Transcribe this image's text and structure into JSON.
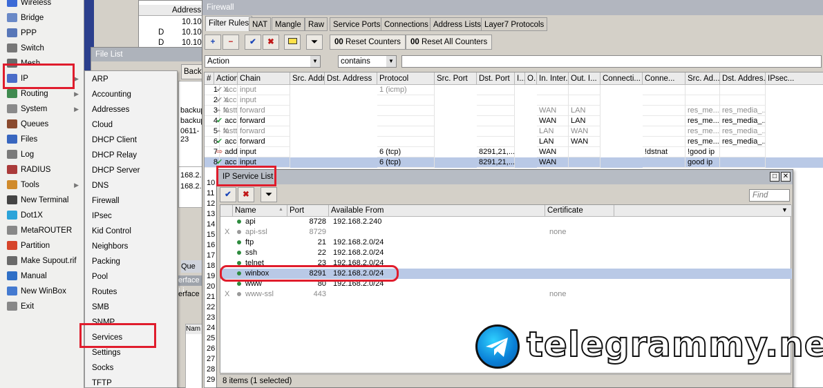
{
  "left_menu": {
    "items": [
      {
        "label": "Wireless",
        "icon": "wireless-icon",
        "arrow": false
      },
      {
        "label": "Bridge",
        "icon": "bridge-icon",
        "arrow": false
      },
      {
        "label": "PPP",
        "icon": "ppp-icon",
        "arrow": false
      },
      {
        "label": "Switch",
        "icon": "switch-icon",
        "arrow": false
      },
      {
        "label": "Mesh",
        "icon": "mesh-icon",
        "arrow": false
      },
      {
        "label": "IP",
        "icon": "ip-icon",
        "arrow": true
      },
      {
        "label": "Routing",
        "icon": "routing-icon",
        "arrow": true
      },
      {
        "label": "System",
        "icon": "system-icon",
        "arrow": true
      },
      {
        "label": "Queues",
        "icon": "queues-icon",
        "arrow": false
      },
      {
        "label": "Files",
        "icon": "files-icon",
        "arrow": false
      },
      {
        "label": "Log",
        "icon": "log-icon",
        "arrow": false
      },
      {
        "label": "RADIUS",
        "icon": "radius-icon",
        "arrow": false
      },
      {
        "label": "Tools",
        "icon": "tools-icon",
        "arrow": true
      },
      {
        "label": "New Terminal",
        "icon": "terminal-icon",
        "arrow": false
      },
      {
        "label": "Dot1X",
        "icon": "dot1x-icon",
        "arrow": false
      },
      {
        "label": "MetaROUTER",
        "icon": "metarouter-icon",
        "arrow": false
      },
      {
        "label": "Partition",
        "icon": "partition-icon",
        "arrow": false
      },
      {
        "label": "Make Supout.rif",
        "icon": "supout-icon",
        "arrow": false
      },
      {
        "label": "Manual",
        "icon": "manual-icon",
        "arrow": false
      },
      {
        "label": "New WinBox",
        "icon": "winbox-icon",
        "arrow": false
      },
      {
        "label": "Exit",
        "icon": "exit-icon",
        "arrow": false
      }
    ]
  },
  "ip_submenu": {
    "items": [
      "ARP",
      "Accounting",
      "Addresses",
      "Cloud",
      "DHCP Client",
      "DHCP Relay",
      "DHCP Server",
      "DNS",
      "Firewall",
      "IPsec",
      "Kid Control",
      "Neighbors",
      "Packing",
      "Pool",
      "Routes",
      "SMB",
      "SNMP",
      "Services",
      "Settings",
      "Socks",
      "TFTP"
    ]
  },
  "background": {
    "top_header": "Address",
    "top_rows": [
      "10.10",
      "10.10",
      "10.10"
    ],
    "top_flags": [
      "",
      "D",
      "D"
    ],
    "file_list_title": "File List",
    "file_list_back": "Back",
    "file_rows": [
      "backup",
      "backup",
      "0611-23"
    ],
    "mid_rows": [
      "168.2.",
      "168.2."
    ],
    "side_labels": [
      "Que",
      "erface Li",
      "erface"
    ],
    "name_col": "Nam"
  },
  "firewall": {
    "title": "Firewall",
    "tabs": [
      "Filter Rules",
      "NAT",
      "Mangle",
      "Raw",
      "Service Ports",
      "Connections",
      "Address Lists",
      "Layer7 Protocols"
    ],
    "active_tab": "Filter Rules",
    "reset_counters": "Reset Counters",
    "reset_all_counters": "Reset All Counters",
    "counter_prefix": "00",
    "filter_field": "Action",
    "filter_op": "contains",
    "columns": [
      "#",
      "Action",
      "Chain",
      "Src. Address",
      "Dst. Address",
      "Protocol",
      "Src. Port",
      "Dst. Port",
      "I...",
      "O...",
      "In. Inter...",
      "Out. I...",
      "Connecti...",
      "Conne...",
      "Src. Ad...",
      "Dst. Addres...",
      "IPsec..."
    ],
    "rows": [
      {
        "n": "1",
        "flag": "X",
        "action": "accept",
        "chain": "input",
        "proto": "1 (icmp)",
        "dport": "",
        "in": "",
        "out": "",
        "conn": "",
        "src": "",
        "dst": "",
        "dim": true
      },
      {
        "n": "2",
        "flag": "X",
        "action": "accept",
        "chain": "input",
        "proto": "",
        "dport": "",
        "in": "",
        "out": "",
        "conn": "",
        "src": "",
        "dst": "",
        "dim": true
      },
      {
        "n": "3",
        "flag": "X",
        "action": "fasttrack ...",
        "chain": "forward",
        "proto": "",
        "dport": "",
        "in": "WAN",
        "out": "LAN",
        "conn": "",
        "src": "res_me...",
        "dst": "res_media_...",
        "dim": true
      },
      {
        "n": "4",
        "flag": "",
        "action": "accept",
        "chain": "forward",
        "proto": "",
        "dport": "",
        "in": "WAN",
        "out": "LAN",
        "conn": "",
        "src": "res_me...",
        "dst": "res_media_...",
        "dim": false
      },
      {
        "n": "5",
        "flag": "X",
        "action": "fasttrack ...",
        "chain": "forward",
        "proto": "",
        "dport": "",
        "in": "LAN",
        "out": "WAN",
        "conn": "",
        "src": "res_me...",
        "dst": "res_media_...",
        "dim": true
      },
      {
        "n": "6",
        "flag": "",
        "action": "accept",
        "chain": "forward",
        "proto": "",
        "dport": "",
        "in": "LAN",
        "out": "WAN",
        "conn": "",
        "src": "res_me...",
        "dst": "res_media_...",
        "dim": false
      },
      {
        "n": "7",
        "flag": "",
        "action": "add src to...",
        "chain": "input",
        "proto": "6 (tcp)",
        "dport": "8291,21,...",
        "in": "WAN",
        "out": "",
        "conn": "!dstnat",
        "src": "!good ip",
        "dst": "",
        "dim": false
      },
      {
        "n": "8",
        "flag": "",
        "action": "accept",
        "chain": "input",
        "proto": "6 (tcp)",
        "dport": "8291,21,...",
        "in": "WAN",
        "out": "",
        "conn": "",
        "src": "good ip",
        "dst": "",
        "dim": false
      }
    ],
    "extra_row_numbers": [
      "10",
      "11",
      "12",
      "13",
      "14",
      "15",
      "16",
      "17",
      "18",
      "19",
      "20",
      "21",
      "22",
      "23",
      "24",
      "25",
      "26",
      "27",
      "28",
      "29"
    ]
  },
  "service_list": {
    "title": "IP Service List",
    "find_placeholder": "Find",
    "columns": [
      "Name",
      "Port",
      "Available From",
      "Certificate"
    ],
    "rows": [
      {
        "flag": "",
        "name": "api",
        "port": "8728",
        "from": "192.168.2.240",
        "cert": "",
        "disabled": false
      },
      {
        "flag": "X",
        "name": "api-ssl",
        "port": "8729",
        "from": "",
        "cert": "none",
        "disabled": true
      },
      {
        "flag": "",
        "name": "ftp",
        "port": "21",
        "from": "192.168.2.0/24",
        "cert": "",
        "disabled": false
      },
      {
        "flag": "",
        "name": "ssh",
        "port": "22",
        "from": "192.168.2.0/24",
        "cert": "",
        "disabled": false
      },
      {
        "flag": "",
        "name": "telnet",
        "port": "23",
        "from": "192.168.2.0/24",
        "cert": "",
        "disabled": false
      },
      {
        "flag": "",
        "name": "winbox",
        "port": "8291",
        "from": "192.168.2.0/24",
        "cert": "",
        "disabled": false
      },
      {
        "flag": "",
        "name": "www",
        "port": "80",
        "from": "192.168.2.0/24",
        "cert": "",
        "disabled": false
      },
      {
        "flag": "X",
        "name": "www-ssl",
        "port": "443",
        "from": "",
        "cert": "none",
        "disabled": true
      }
    ],
    "selected_row": "winbox",
    "status": "8 items (1 selected)"
  },
  "watermark": {
    "text": "telegrammy.net"
  },
  "colors": {
    "highlight_red": "#e01c2c",
    "selection_blue": "#b9c9e6",
    "accept_green": "#2ea043",
    "brand_blue": "#2b3f8d"
  }
}
